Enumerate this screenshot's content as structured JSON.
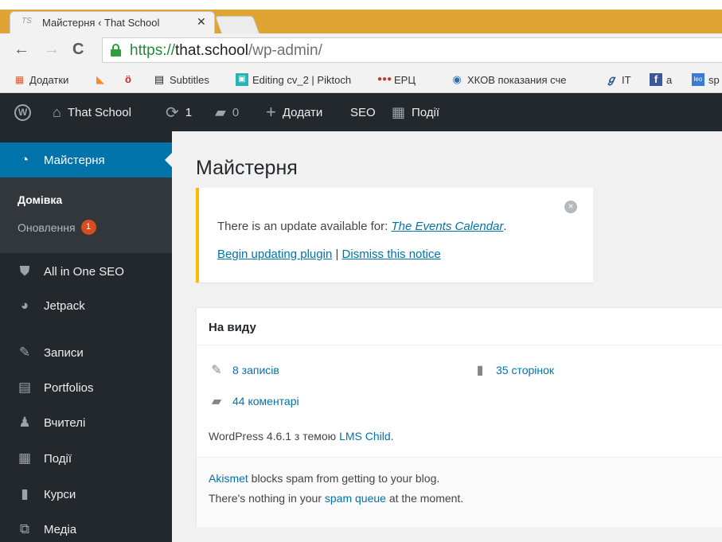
{
  "browser": {
    "tab_title": "Майстерня ‹ That School",
    "tab_favicon": "TS",
    "url_scheme": "https://",
    "url_host": "that.school",
    "url_path": "/wp-admin/",
    "bookmarks": [
      {
        "icon": "apps-icon",
        "label": "Додатки"
      },
      {
        "icon": "cat-icon",
        "label": ""
      },
      {
        "icon": "letter-icon",
        "label": ""
      },
      {
        "icon": "film-icon",
        "label": "Subtitles"
      },
      {
        "icon": "piktochart-icon",
        "label": "Editing cv_2 | Piktoch"
      },
      {
        "icon": "dots-icon",
        "label": "ЕРЦ"
      },
      {
        "icon": "globe-icon",
        "label": "ХКОВ показания сче"
      },
      {
        "icon": "it-icon",
        "label": "IT"
      },
      {
        "icon": "facebook-icon",
        "label": "a"
      },
      {
        "icon": "leo-icon",
        "label": "sp"
      }
    ]
  },
  "adminbar": {
    "site_name": "That School",
    "updates_count": "1",
    "comments_count": "0",
    "add_label": "Додати",
    "seo_label": "SEO",
    "events_label": "Події"
  },
  "sidebar": {
    "current": "Майстерня",
    "sub_home": "Домівка",
    "sub_updates": "Оновлення",
    "updates_badge": "1",
    "items": [
      {
        "label": "All in One SEO",
        "icon": "shield-icon"
      },
      {
        "label": "Jetpack",
        "icon": "jetpack-icon"
      },
      {
        "label": "Записи",
        "icon": "pin-icon"
      },
      {
        "label": "Portfolios",
        "icon": "portfolio-icon"
      },
      {
        "label": "Вчителі",
        "icon": "people-icon"
      },
      {
        "label": "Події",
        "icon": "calendar-icon"
      },
      {
        "label": "Курси",
        "icon": "book-icon"
      },
      {
        "label": "Медіа",
        "icon": "media-icon"
      }
    ]
  },
  "main": {
    "title": "Майстерня",
    "notice": {
      "text": "There is an update available for: ",
      "plugin": "The Events Calendar",
      "period": ".",
      "begin_link": "Begin updating plugin",
      "separator": " | ",
      "dismiss_link": "Dismiss this notice"
    },
    "glance": {
      "title": "На виду",
      "posts": "8 записів",
      "pages": "35 сторінок",
      "comments": "44 коментарі",
      "version_text": "WordPress 4.6.1 з темою ",
      "theme_link": "LMS Child",
      "version_period": ".",
      "akismet_link": "Akismet",
      "akismet_text": " blocks spam from getting to your blog.",
      "spam_prefix": "There's nothing in your ",
      "spam_link": "spam queue",
      "spam_suffix": " at the moment."
    }
  },
  "colors": {
    "tab_strip": "#e0a435",
    "adminbar": "#23282d",
    "menu_current": "#0073aa",
    "notice_border": "#ffb900",
    "badge": "#d54e21"
  }
}
